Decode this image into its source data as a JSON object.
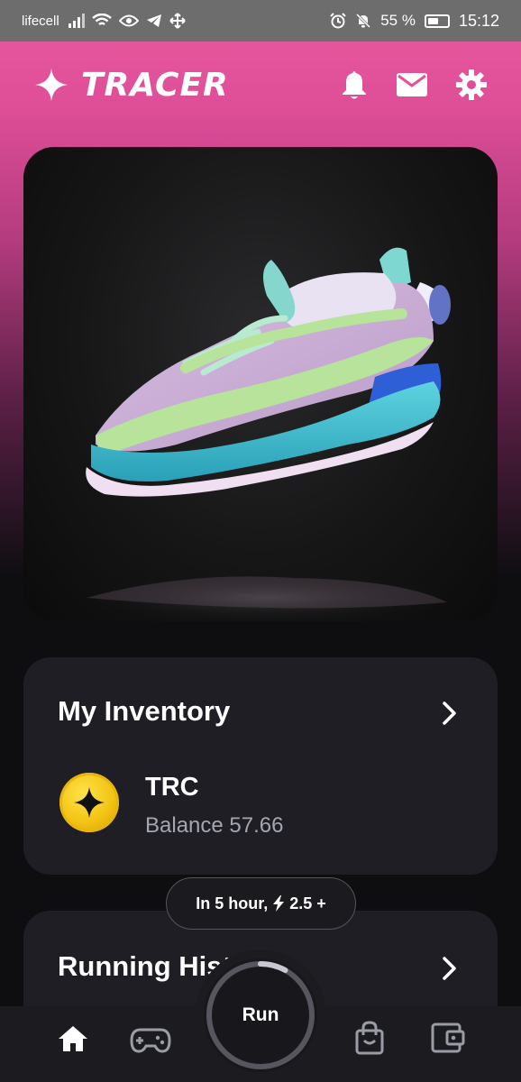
{
  "status_bar": {
    "carrier": "lifecell",
    "battery_percent": "55 %",
    "time": "15:12"
  },
  "header": {
    "logo_text": "TRACER",
    "icons": [
      "bell-icon",
      "mail-icon",
      "gear-icon"
    ]
  },
  "hero": {
    "image": "3d-sneaker"
  },
  "inventory": {
    "title": "My Inventory",
    "token_symbol": "TRC",
    "balance": "Balance 57.66"
  },
  "history": {
    "title": "Running Hist"
  },
  "tooltip": {
    "text_prefix": "In 5 hour,",
    "text_value": "2.5 +"
  },
  "nav": {
    "run_label": "Run",
    "run_progress": 0.08,
    "items": [
      "home-icon",
      "gamepad-icon",
      "shopping-bag-icon",
      "wallet-icon"
    ]
  },
  "colors": {
    "brand_pink": "#ea5aa0",
    "card_bg": "#1e1e24",
    "coin_gold": "#f2c413"
  }
}
